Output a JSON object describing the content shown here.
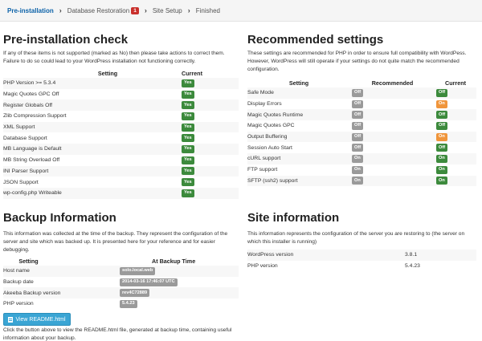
{
  "breadcrumb": {
    "steps": [
      "Pre-installation",
      "Database Restoration",
      "Site Setup",
      "Finished"
    ],
    "db_badge": "1"
  },
  "colors": {
    "accent": "#0a61a8",
    "success": "#3c8a3c",
    "warning": "#f0953b",
    "muted": "#9a9a9a",
    "danger": "#c9302c",
    "button": "#3aa5d4"
  },
  "preinstall": {
    "title": "Pre-installation check",
    "description": "If any of these items is not supported (marked as No) then please take actions to correct them. Failure to do so could lead to your WordPress installation not functioning correctly.",
    "col_setting": "Setting",
    "col_current": "Current",
    "rows": [
      {
        "setting": "PHP Version >= 5.3.4",
        "current": "Yes"
      },
      {
        "setting": "Magic Quotes GPC Off",
        "current": "Yes"
      },
      {
        "setting": "Register Globals Off",
        "current": "Yes"
      },
      {
        "setting": "Zlib Compression Support",
        "current": "Yes"
      },
      {
        "setting": "XML Support",
        "current": "Yes"
      },
      {
        "setting": "Database Support",
        "current": "Yes"
      },
      {
        "setting": "MB Language is Default",
        "current": "Yes"
      },
      {
        "setting": "MB String Overload Off",
        "current": "Yes"
      },
      {
        "setting": "INI Parser Support",
        "current": "Yes"
      },
      {
        "setting": "JSON Support",
        "current": "Yes"
      },
      {
        "setting": "wp-config.php Writeable",
        "current": "Yes"
      }
    ]
  },
  "recommended": {
    "title": "Recommended settings",
    "description": "These settings are recommended for PHP in order to ensure full compatibility with WordPess. However, WordPress will still operate if your settings do not quite match the recommended configuration.",
    "col_setting": "Setting",
    "col_recommended": "Recommended",
    "col_current": "Current",
    "rows": [
      {
        "setting": "Safe Mode",
        "recommended": "Off",
        "current": "Off",
        "current_status": "success"
      },
      {
        "setting": "Display Errors",
        "recommended": "Off",
        "current": "On",
        "current_status": "warning"
      },
      {
        "setting": "Magic Quotes Runtime",
        "recommended": "Off",
        "current": "Off",
        "current_status": "success"
      },
      {
        "setting": "Magic Quotes GPC",
        "recommended": "Off",
        "current": "Off",
        "current_status": "success"
      },
      {
        "setting": "Output Buffering",
        "recommended": "Off",
        "current": "On",
        "current_status": "warning"
      },
      {
        "setting": "Session Auto Start",
        "recommended": "Off",
        "current": "Off",
        "current_status": "success"
      },
      {
        "setting": "cURL support",
        "recommended": "On",
        "current": "On",
        "current_status": "success"
      },
      {
        "setting": "FTP support",
        "recommended": "On",
        "current": "On",
        "current_status": "success"
      },
      {
        "setting": "SFTP (ssh2) support",
        "recommended": "On",
        "current": "On",
        "current_status": "success"
      }
    ]
  },
  "backup": {
    "title": "Backup Information",
    "description": "This information was collected at the time of the backup. They represent the configuration of the server and site which was backed up. It is presented here for your reference and for easier debugging.",
    "col_setting": "Setting",
    "col_time": "At Backup Time",
    "rows": [
      {
        "setting": "Host name",
        "value": "solo.local.web"
      },
      {
        "setting": "Backup date",
        "value": "2014-03-16 17:46:07 UTC"
      },
      {
        "setting": "Akeeba Backup version",
        "value": "rev4C72889"
      },
      {
        "setting": "PHP version",
        "value": "5.4.23"
      }
    ],
    "button_label": "View README.html",
    "note": "Click the button above to view the README.html file, generated at backup time, containing useful information about your backup."
  },
  "siteinfo": {
    "title": "Site information",
    "description": "This information represents the configuration of the server you are restoring to (the server on which this installer is running)",
    "rows": [
      {
        "setting": "WordPress version",
        "value": "3.8.1"
      },
      {
        "setting": "PHP version",
        "value": "5.4.23"
      }
    ]
  }
}
